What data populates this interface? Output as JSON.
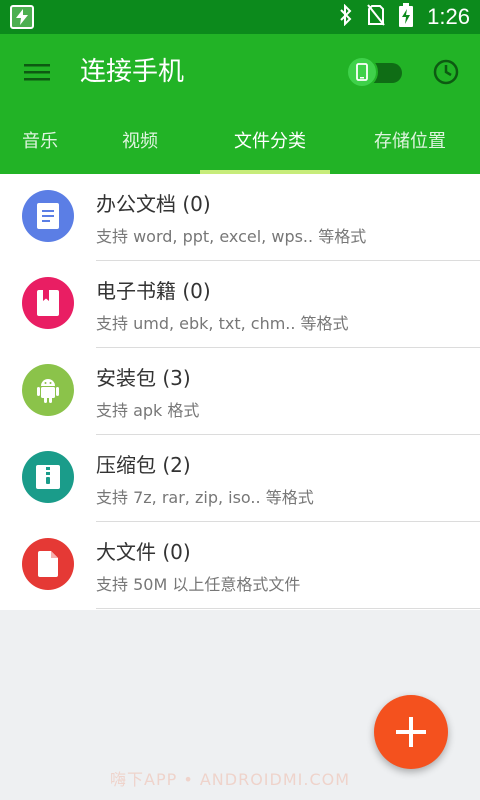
{
  "status_bar": {
    "time": "1:26",
    "icons": [
      "app-badge-icon",
      "bluetooth-icon",
      "no-sim-icon",
      "battery-charging-icon"
    ]
  },
  "app_bar": {
    "title": "连接手机",
    "menu_icon": "hamburger-menu-icon",
    "toggle_icon": "phone-icon",
    "history_icon": "clock-icon",
    "colors": {
      "background": "#22b326",
      "status_bar": "#0c8a1c",
      "indicator": "#c7ec7a"
    }
  },
  "tabs": [
    {
      "label": "音乐",
      "active": false
    },
    {
      "label": "视频",
      "active": false
    },
    {
      "label": "文件分类",
      "active": true
    },
    {
      "label": "存储位置",
      "active": false
    }
  ],
  "categories": [
    {
      "name": "办公文档 (0)",
      "desc": "支持 word, ppt, excel, wps.. 等格式",
      "icon": "document-icon",
      "color": "#5b7ee5"
    },
    {
      "name": "电子书籍 (0)",
      "desc": "支持 umd, ebk, txt, chm.. 等格式",
      "icon": "book-icon",
      "color": "#e91e63"
    },
    {
      "name": "安装包 (3)",
      "desc": "支持 apk 格式",
      "icon": "android-icon",
      "color": "#8bc34a"
    },
    {
      "name": "压缩包 (2)",
      "desc": "支持 7z, rar, zip, iso.. 等格式",
      "icon": "archive-icon",
      "color": "#1a9c8a"
    },
    {
      "name": "大文件 (0)",
      "desc": "支持 50M 以上任意格式文件",
      "icon": "file-icon",
      "color": "#e53935"
    }
  ],
  "fab": {
    "icon": "plus-icon",
    "color": "#f4511e"
  },
  "watermark": "嗨下APP • ANDROIDMI.COM"
}
